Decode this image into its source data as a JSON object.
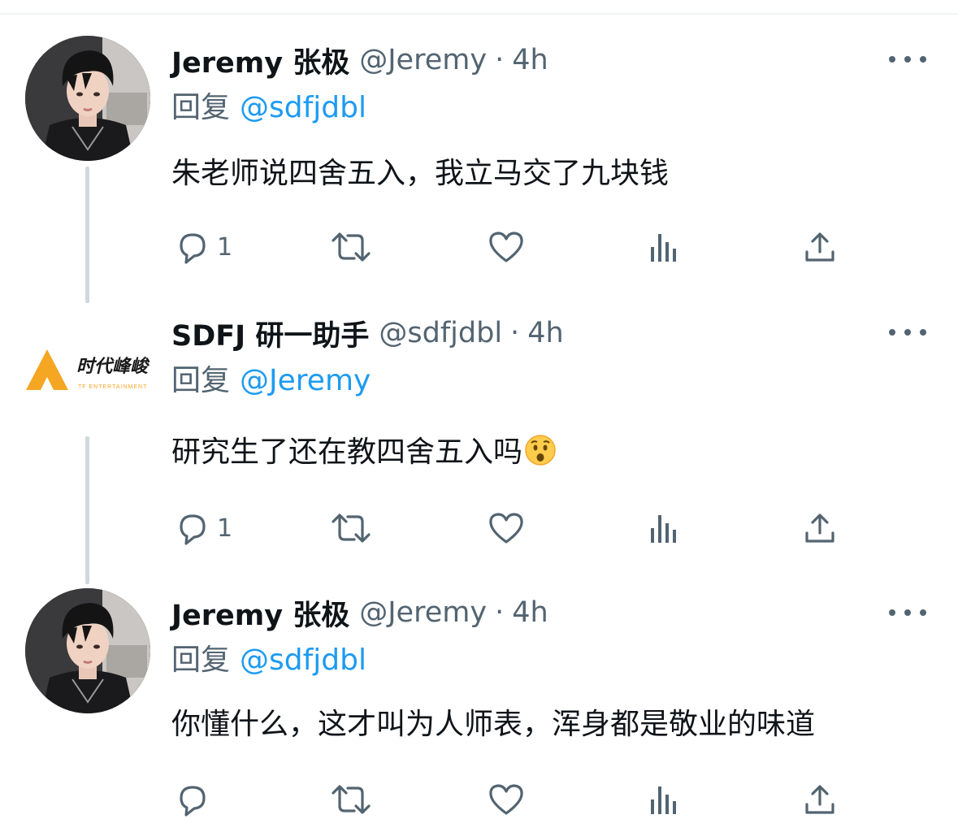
{
  "tweets": [
    {
      "author": {
        "name": "Jeremy 张极",
        "handle": "@Jeremy"
      },
      "sep": "·",
      "time": "4h",
      "reply_label": "回复",
      "reply_to": "@sdfjdbl",
      "text": "朱老师说四舍五入，我立马交了九块钱",
      "replies": "1"
    },
    {
      "author": {
        "name": "SDFJ 研一助手",
        "handle": "@sdfjdbl"
      },
      "sep": "·",
      "time": "4h",
      "reply_label": "回复",
      "reply_to": "@Jeremy",
      "text": "研究生了还在教四舍五入吗",
      "emoji": "hushed-face-emoji",
      "replies": "1",
      "logo_text": "时代峰峻",
      "logo_sub": "TF ENTERTAINMENT"
    },
    {
      "author": {
        "name": "Jeremy 张极",
        "handle": "@Jeremy"
      },
      "sep": "·",
      "time": "4h",
      "reply_label": "回复",
      "reply_to": "@sdfjdbl",
      "text": "你懂什么，这才叫为人师表，浑身都是敬业的味道",
      "replies": ""
    }
  ],
  "icons": [
    "reply-icon",
    "retweet-icon",
    "like-icon",
    "views-icon",
    "share-icon",
    "more-icon"
  ],
  "colors": {
    "text": "#0f1419",
    "muted": "#536471",
    "link": "#1d9bf0",
    "thread_line": "#cfd9de",
    "logo_orange": "#f5a623"
  }
}
